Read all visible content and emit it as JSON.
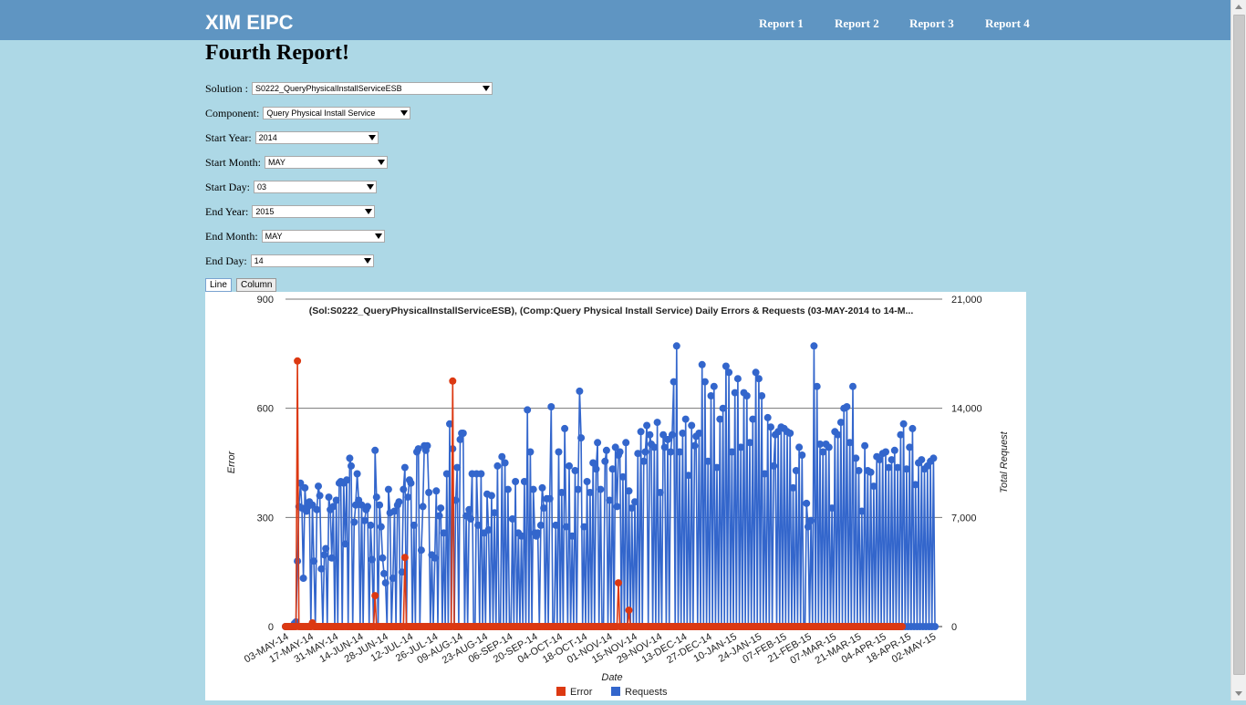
{
  "header": {
    "brand": "XIM EIPC",
    "nav": [
      "Report 1",
      "Report 2",
      "Report 3",
      "Report 4"
    ]
  },
  "page": {
    "title": "Fourth Report!"
  },
  "form": {
    "solution": {
      "label": "Solution :",
      "value": "S0222_QueryPhysicalInstallServiceESB"
    },
    "component": {
      "label": "Component:",
      "value": "Query Physical Install Service"
    },
    "start_year": {
      "label": "Start Year:",
      "value": "2014"
    },
    "start_month": {
      "label": "Start Month:",
      "value": "MAY"
    },
    "start_day": {
      "label": "Start Day:",
      "value": "03"
    },
    "end_year": {
      "label": "End Year:",
      "value": "2015"
    },
    "end_month": {
      "label": "End Month:",
      "value": "MAY"
    },
    "end_day": {
      "label": "End Day:",
      "value": "14"
    }
  },
  "chart_toggle": {
    "line": "Line",
    "column": "Column",
    "active": "Line"
  },
  "chart_data": {
    "type": "line",
    "title": "(Sol:S0222_QueryPhysicalInstallServiceESB), (Comp:Query Physical Install Service) Daily Errors & Requests (03-MAY-2014 to 14-M...",
    "xlabel": "Date",
    "ylabel_left": "Error",
    "ylabel_right": "Total Request",
    "ylim_left": [
      0,
      900
    ],
    "ylim_right": [
      0,
      21000
    ],
    "yticks_left": [
      "0",
      "300",
      "600",
      "900"
    ],
    "yticks_right": [
      "0",
      "7,000",
      "14,000",
      "21,000"
    ],
    "grid": true,
    "legend_position": "bottom",
    "x_tick_labels": [
      "03-MAY-14",
      "17-MAY-14",
      "31-MAY-14",
      "14-JUN-14",
      "28-JUN-14",
      "12-JUL-14",
      "26-JUL-14",
      "09-AUG-14",
      "23-AUG-14",
      "06-SEP-14",
      "20-SEP-14",
      "04-OCT-14",
      "18-OCT-14",
      "01-NOV-14",
      "15-NOV-14",
      "29-NOV-14",
      "13-DEC-14",
      "27-DEC-14",
      "10-JAN-15",
      "24-JAN-15",
      "07-FEB-15",
      "21-FEB-15",
      "07-MAR-15",
      "21-MAR-15",
      "04-APR-15",
      "18-APR-15",
      "02-MAY-15"
    ],
    "series": [
      {
        "name": "Error",
        "color": "#dc3912",
        "axis": "left",
        "values": [
          0,
          0,
          0,
          0,
          0,
          0,
          0,
          0,
          730,
          0,
          0,
          0,
          0,
          0,
          0,
          0,
          0,
          0,
          10,
          0,
          0,
          0,
          0,
          0,
          0,
          0,
          0,
          0,
          0,
          0,
          0,
          0,
          0,
          0,
          0,
          0,
          0,
          0,
          0,
          0,
          0,
          0,
          0,
          0,
          0,
          0,
          0,
          0,
          0,
          0,
          0,
          0,
          0,
          0,
          0,
          0,
          0,
          0,
          0,
          0,
          85,
          0,
          0,
          0,
          0,
          0,
          0,
          0,
          0,
          0,
          0,
          0,
          0,
          0,
          0,
          0,
          0,
          0,
          0,
          0,
          190,
          0,
          0,
          0,
          0,
          0,
          0,
          0,
          0,
          0,
          0,
          0,
          0,
          0,
          0,
          0,
          0,
          0,
          0,
          0,
          0,
          0,
          0,
          0,
          0,
          0,
          0,
          0,
          0,
          0,
          0,
          0,
          675,
          0,
          0,
          0,
          0,
          0,
          0,
          0,
          0,
          0,
          0,
          0,
          0,
          0,
          0,
          0,
          0,
          0,
          0,
          0,
          0,
          0,
          0,
          0,
          0,
          0,
          0,
          0,
          0,
          0,
          0,
          0,
          0,
          0,
          0,
          0,
          0,
          0,
          0,
          0,
          0,
          0,
          0,
          0,
          0,
          0,
          0,
          0,
          0,
          0,
          0,
          0,
          0,
          0,
          0,
          0,
          0,
          0,
          0,
          0,
          0,
          0,
          0,
          0,
          0,
          0,
          0,
          0,
          0,
          0,
          0,
          0,
          0,
          0,
          0,
          0,
          0,
          0,
          0,
          0,
          0,
          0,
          0,
          0,
          0,
          0,
          0,
          0,
          0,
          0,
          0,
          0,
          0,
          0,
          0,
          0,
          0,
          0,
          0,
          0,
          0,
          0,
          0,
          0,
          0,
          0,
          0,
          0,
          0,
          0,
          0,
          120,
          0,
          0,
          0,
          0,
          0,
          0,
          45,
          0,
          0,
          0,
          0,
          0,
          0,
          0,
          0,
          0,
          0,
          0,
          0,
          0,
          0,
          0,
          0,
          0,
          0,
          0,
          0,
          0,
          0,
          0,
          0,
          0,
          0,
          0,
          0,
          0,
          0,
          0,
          0,
          0,
          0,
          0,
          0,
          0,
          0,
          0,
          0,
          0,
          0,
          0,
          0,
          0,
          0,
          0,
          0,
          0,
          0,
          0,
          0,
          0,
          0,
          0,
          0,
          0,
          0,
          0,
          0,
          0,
          0,
          0,
          0,
          0,
          0,
          0,
          0,
          0,
          0,
          0,
          0,
          0,
          0,
          0,
          0,
          0,
          0,
          0,
          0,
          0,
          0,
          0,
          0,
          0,
          0,
          0,
          0,
          0,
          0,
          0,
          0,
          0,
          0,
          0,
          0,
          0,
          0,
          0,
          0,
          0,
          0,
          0,
          0,
          0,
          0,
          0,
          0,
          0,
          0,
          0,
          0,
          0,
          0,
          0,
          0,
          0,
          0,
          0,
          0,
          0,
          0,
          0,
          0,
          0,
          0,
          0,
          0,
          0,
          0,
          0,
          0,
          0,
          0,
          0,
          0,
          0,
          0,
          0,
          0,
          0,
          0,
          0,
          0,
          0,
          0,
          0,
          0,
          0,
          0,
          0,
          0,
          0,
          0,
          0,
          0,
          0,
          0,
          0,
          0,
          0,
          0,
          0,
          0,
          0,
          0,
          0,
          0,
          0,
          0,
          0,
          0,
          0,
          0,
          0,
          0,
          0,
          0,
          0,
          0,
          0,
          0,
          0
        ]
      },
      {
        "name": "Requests",
        "color": "#3366cc",
        "axis": "right",
        "values": [
          0,
          0,
          0,
          0,
          0,
          50,
          200,
          300,
          4200,
          7700,
          9200,
          7600,
          3100,
          8900,
          7400,
          7700,
          8000,
          0,
          7800,
          4200,
          0,
          7500,
          9000,
          8400,
          3700,
          0,
          4600,
          5000,
          0,
          8300,
          7500,
          4400,
          7700,
          0,
          8100,
          0,
          9200,
          9300,
          0,
          9200,
          5300,
          9400,
          0,
          10800,
          10300,
          0,
          6700,
          7800,
          9800,
          8100,
          0,
          7800,
          0,
          6800,
          7500,
          7700,
          0,
          6500,
          4300,
          0,
          11300,
          8300,
          0,
          7800,
          6400,
          4400,
          3400,
          2800,
          0,
          8800,
          7300,
          0,
          3100,
          7400,
          0,
          7800,
          8000,
          0,
          3500,
          8800,
          10200,
          0,
          8300,
          9400,
          9200,
          0,
          6500,
          0,
          11200,
          11400,
          0,
          4900,
          7700,
          11600,
          11300,
          11600,
          8600,
          0,
          4600,
          0,
          4400,
          8700,
          0,
          7100,
          7600,
          0,
          6000,
          0,
          9800,
          0,
          13000,
          0,
          11400,
          0,
          8100,
          10200,
          0,
          12000,
          12400,
          12400,
          0,
          7100,
          0,
          7500,
          6900,
          9800,
          0,
          0,
          9800,
          6500,
          0,
          9800,
          0,
          6000,
          0,
          8500,
          6200,
          0,
          8400,
          0,
          7300,
          0,
          10300,
          0,
          0,
          10900,
          0,
          10500,
          0,
          8800,
          0,
          0,
          6900,
          0,
          9300,
          0,
          6000,
          0,
          5800,
          0,
          9300,
          0,
          13900,
          0,
          11200,
          0,
          8800,
          6000,
          5800,
          6000,
          0,
          6500,
          8900,
          7600,
          0,
          8200,
          0,
          8200,
          14100,
          0,
          0,
          6500,
          0,
          11200,
          0,
          8600,
          0,
          12700,
          6400,
          0,
          10300,
          0,
          5800,
          0,
          10000,
          0,
          8800,
          15100,
          12100,
          0,
          6400,
          0,
          9300,
          0,
          8600,
          0,
          10500,
          0,
          10100,
          11800,
          0,
          8800,
          0,
          0,
          10600,
          11300,
          0,
          8100,
          0,
          10100,
          0,
          11500,
          7700,
          11000,
          11200,
          0,
          9600,
          0,
          11800,
          0,
          8700,
          0,
          7600,
          0,
          8000,
          0,
          11100,
          0,
          12500,
          0,
          10600,
          11200,
          12900,
          0,
          12300,
          11700,
          0,
          11500,
          0,
          13100,
          0,
          8600,
          0,
          12300,
          11500,
          0,
          12000,
          0,
          11200,
          12300,
          15700,
          0,
          18000,
          0,
          11200,
          0,
          12400,
          0,
          13300,
          0,
          9700,
          0,
          12900,
          0,
          11600,
          12200,
          0,
          12400,
          0,
          16800,
          0,
          15700,
          0,
          10600,
          0,
          14800,
          0,
          15400,
          0,
          10200,
          0,
          13300,
          0,
          14000,
          0,
          16700,
          0,
          16300,
          0,
          11200,
          0,
          15000,
          0,
          15900,
          0,
          11500,
          0,
          15000,
          0,
          14800,
          0,
          11800,
          0,
          13300,
          0,
          16300,
          0,
          15900,
          0,
          14800,
          0,
          9800,
          0,
          13400,
          0,
          12800,
          0,
          10300,
          12300,
          0,
          12500,
          0,
          12800,
          0,
          12700,
          0,
          12500,
          0,
          12400,
          0,
          8900,
          0,
          10000,
          0,
          11500,
          0,
          11000,
          0,
          0,
          7900,
          6400,
          0,
          6800,
          0,
          18000,
          0,
          15400,
          0,
          11700,
          0,
          11200,
          0,
          11700,
          0,
          11500,
          0,
          7600,
          0,
          12500,
          0,
          12300,
          0,
          13100,
          0,
          14000,
          0,
          14100,
          0,
          11800,
          0,
          15400,
          0,
          10800,
          0,
          10000,
          0,
          7400,
          0,
          11600,
          0,
          10000,
          0,
          9900,
          0,
          9000,
          0,
          10900,
          0,
          10700,
          0,
          11100,
          0,
          11200,
          0,
          10200,
          0,
          10700,
          0,
          11300,
          0,
          10200,
          0,
          12300,
          0,
          13000,
          0,
          10100,
          0,
          11500,
          0,
          12700,
          0,
          9100,
          0,
          10500,
          0,
          10700,
          0,
          10100,
          0,
          10300,
          0,
          10600,
          0,
          10800,
          0
        ]
      }
    ]
  }
}
